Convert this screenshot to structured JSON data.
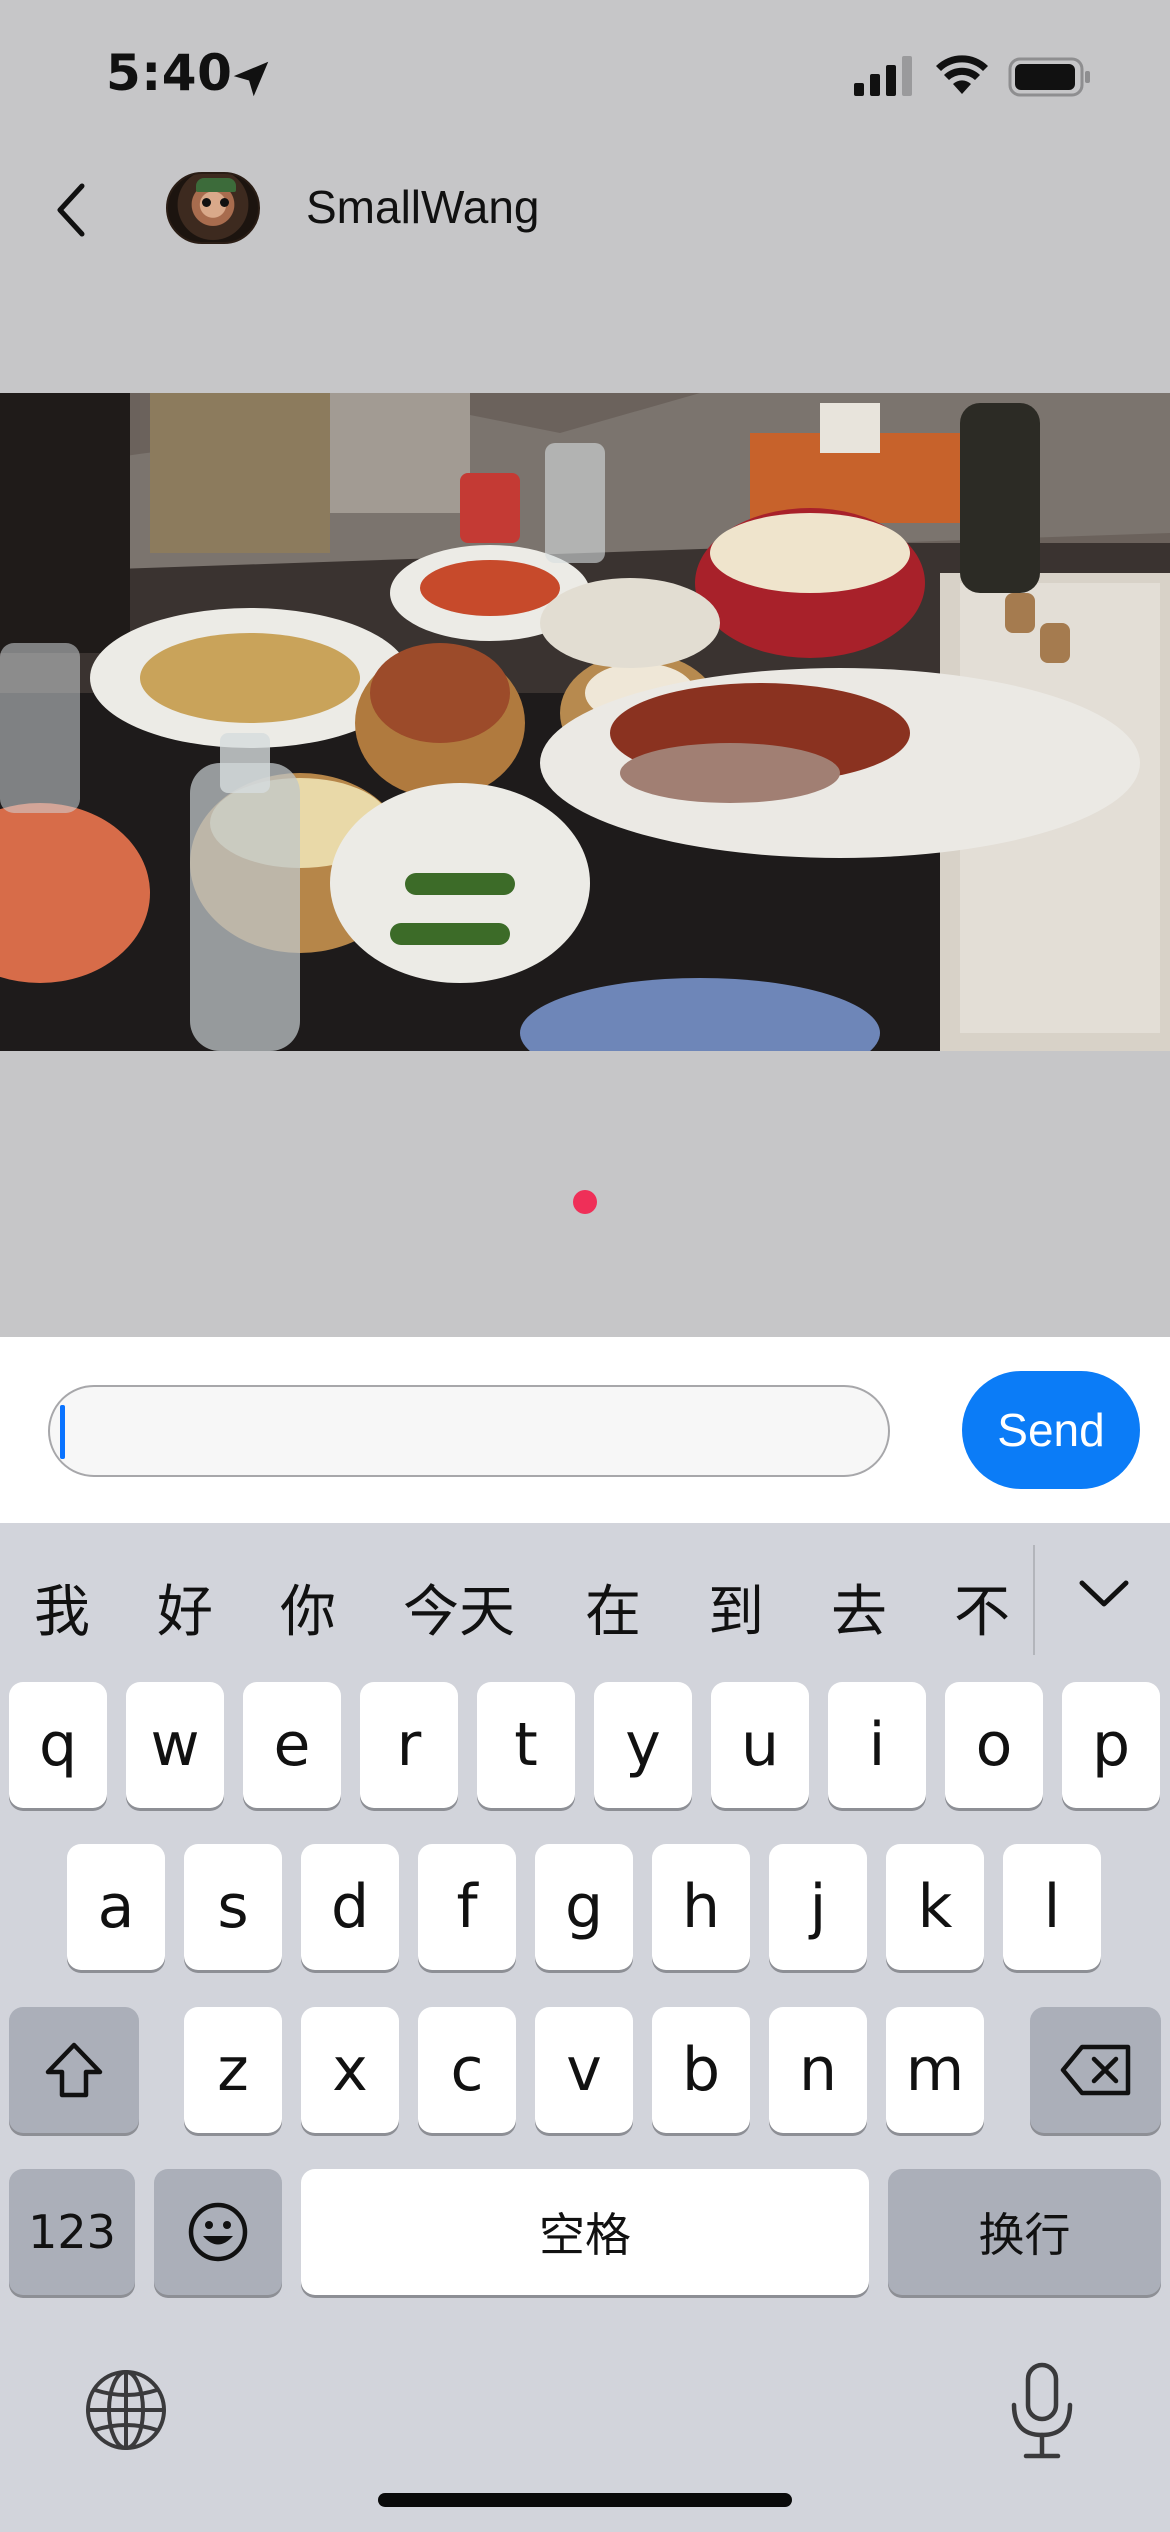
{
  "status_bar": {
    "time": "5:40",
    "icons": [
      "location-arrow-icon",
      "cellular-signal-icon",
      "wifi-icon",
      "battery-icon"
    ]
  },
  "header": {
    "back_icon": "chevron-left-icon",
    "username": "SmallWang"
  },
  "media": {
    "description_icon": "photo",
    "page_indicator_color": "#ef2f58"
  },
  "composer": {
    "input_value": "",
    "send_label": "Send",
    "send_color": "#0b7cf7"
  },
  "keyboard": {
    "candidates": [
      "我",
      "好",
      "你",
      "今天",
      "在",
      "到",
      "去",
      "不"
    ],
    "row1": [
      "q",
      "w",
      "e",
      "r",
      "t",
      "y",
      "u",
      "i",
      "o",
      "p"
    ],
    "row2": [
      "a",
      "s",
      "d",
      "f",
      "g",
      "h",
      "j",
      "k",
      "l"
    ],
    "row3": [
      "z",
      "x",
      "c",
      "v",
      "b",
      "n",
      "m"
    ],
    "numbers_label": "123",
    "space_label": "空格",
    "return_label": "换行",
    "icons": [
      "chevron-down-icon",
      "shift-icon",
      "delete-icon",
      "emoji-icon",
      "globe-icon",
      "microphone-icon"
    ]
  }
}
